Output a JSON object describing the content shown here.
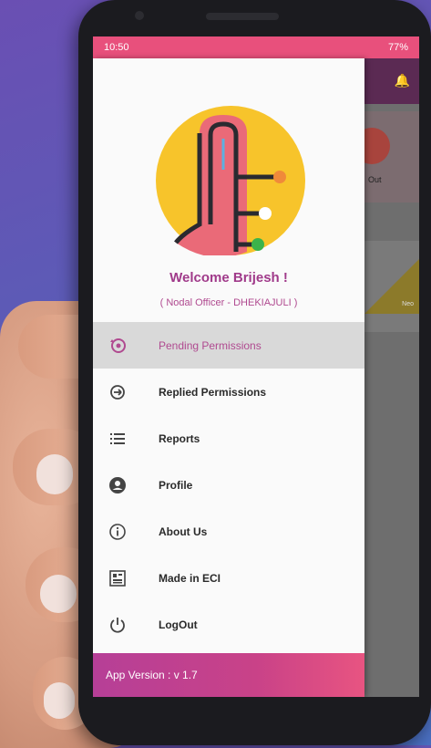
{
  "status_bar": {
    "time": "10:50",
    "right_text": "77%"
  },
  "user": {
    "welcome": "Welcome Brijesh !",
    "role": "( Nodal Officer - DHEKIAJULI )"
  },
  "menu": [
    {
      "label": "Pending Permissions",
      "icon": "pending-permissions-icon",
      "active": true
    },
    {
      "label": "Replied Permissions",
      "icon": "replied-permissions-icon",
      "active": false
    },
    {
      "label": "Reports",
      "icon": "list-icon",
      "active": false
    },
    {
      "label": "Profile",
      "icon": "profile-icon",
      "active": false
    },
    {
      "label": "About Us",
      "icon": "info-icon",
      "active": false
    },
    {
      "label": "Made in ECI",
      "icon": "made-in-eci-icon",
      "active": false
    },
    {
      "label": "LogOut",
      "icon": "power-icon",
      "active": false
    }
  ],
  "footer": {
    "version": "App Version : v 1.7"
  },
  "background_app": {
    "card_text": "Out",
    "card2_text": "Neo"
  },
  "colors": {
    "accent": "#b04a90",
    "status_bar": "#e8507c",
    "footer_start": "#b63f97",
    "footer_end": "#e85481",
    "logo_yellow": "#f7c42b",
    "logo_finger": "#ea6a78"
  }
}
